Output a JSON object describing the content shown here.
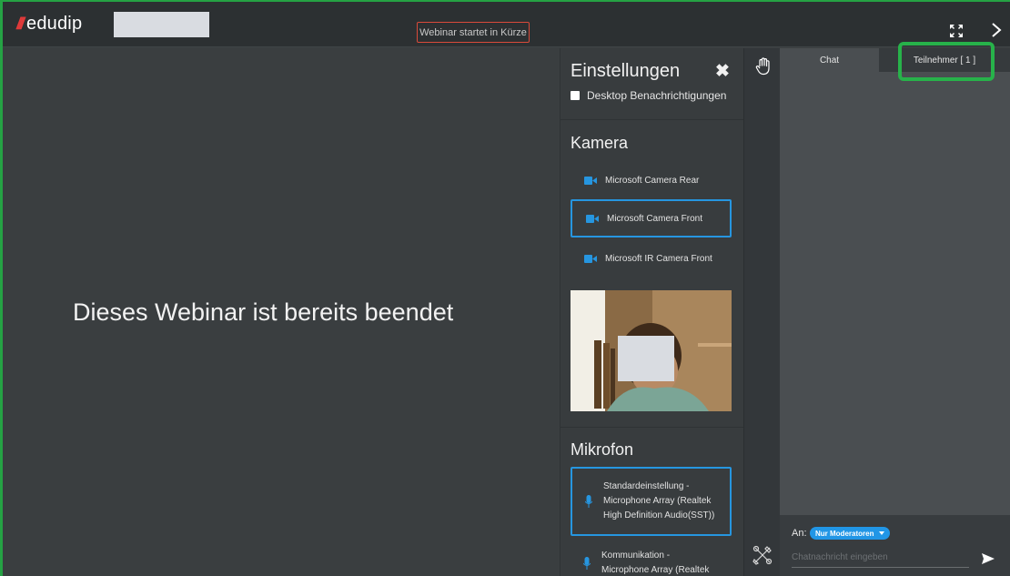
{
  "header": {
    "logo_text": "edudip",
    "logo_slashes": "///",
    "status_badge": "Webinar startet in Kürze",
    "icons": [
      "fullscreen-icon",
      "chevron-right-icon"
    ]
  },
  "stage": {
    "message": "Dieses Webinar ist bereits beendet"
  },
  "settings": {
    "title": "Einstellungen",
    "close_glyph": "✖",
    "notifications_label": "Desktop Benachrichtigungen",
    "notifications_checked": false,
    "camera": {
      "title": "Kamera",
      "devices": [
        {
          "label": "Microsoft Camera Rear",
          "selected": false
        },
        {
          "label": "Microsoft Camera Front",
          "selected": true
        },
        {
          "label": "Microsoft IR Camera Front",
          "selected": false
        }
      ]
    },
    "microphone": {
      "title": "Mikrofon",
      "devices": [
        {
          "lines": [
            "Standardeinstellung -",
            "Microphone Array (Realtek",
            "High Definition Audio(SST))"
          ],
          "selected": true
        },
        {
          "lines": [
            "Kommunikation -",
            "Microphone Array (Realtek"
          ],
          "selected": false
        }
      ]
    }
  },
  "chat": {
    "tabs": [
      {
        "label": "Chat",
        "active": false
      },
      {
        "label": "Teilnehmer [ 1 ]",
        "active": true
      }
    ],
    "to_label": "An:",
    "recipient": "Nur Moderatoren",
    "input_placeholder": "Chatnachricht eingeben"
  },
  "colors": {
    "accent_blue": "#2696e0",
    "badge_border": "#d94a3a",
    "highlight_green": "#27b24a",
    "logo_red": "#e23a3a"
  }
}
